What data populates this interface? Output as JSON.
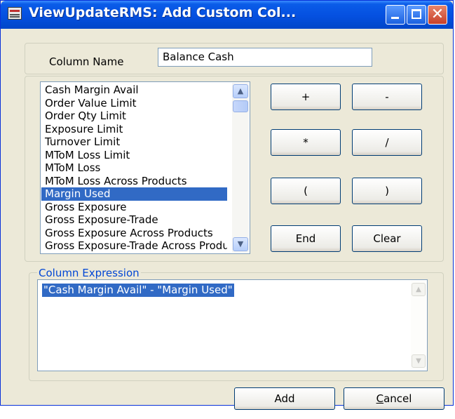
{
  "window": {
    "title": "ViewUpdateRMS: Add Custom Col...",
    "controls": {
      "minimize": "",
      "maximize": "",
      "close": "✕"
    }
  },
  "column_name": {
    "label": "Column Name",
    "value": "Balance Cash"
  },
  "fields_list": {
    "items": [
      "Cash Margin Avail",
      "Order Value Limit",
      "Order Qty Limit",
      "Exposure Limit",
      "Turnover Limit",
      "MToM Loss Limit",
      "MToM Loss",
      "MToM Loss Across Products",
      "Margin Used",
      "Gross Exposure",
      "Gross Exposure-Trade",
      "Gross Exposure Across Products",
      "Gross Exposure-Trade Across Products"
    ],
    "selected": "Margin Used"
  },
  "operators": {
    "plus": "+",
    "minus": "-",
    "multiply": "*",
    "divide": "/",
    "open_paren": "(",
    "close_paren": ")",
    "end": "End",
    "clear": "Clear"
  },
  "expression": {
    "legend": "Column Expression",
    "value": "\"Cash Margin Avail\" - \"Margin Used\""
  },
  "dialog_buttons": {
    "add": "Add",
    "cancel_rest": "ancel",
    "cancel_mnemonic": "C"
  },
  "colors": {
    "title_bar": "#0550e0",
    "selection": "#316ac5",
    "legend_text": "#0046d5",
    "window_face": "#ece9d8"
  }
}
